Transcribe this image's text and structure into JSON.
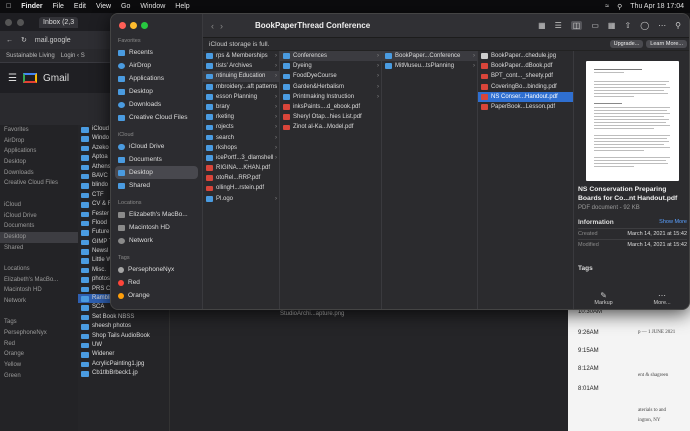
{
  "menubar": {
    "app": "Finder",
    "items": [
      "File",
      "Edit",
      "View",
      "Go",
      "Window",
      "Help"
    ],
    "datetime": "Thu Apr 18  17:04"
  },
  "chrome": {
    "tab_title": "Inbox (2,3",
    "url": "mail.google",
    "bookmarks": [
      "Sustainable Living",
      "Login ‹ S"
    ],
    "gmail_label": "Gmail"
  },
  "colors": {
    "accent": "#2f6fd0",
    "folder": "#4a9be0",
    "pdf": "#d9453a",
    "tag_red": "#ff453a",
    "tag_orange": "#ff9f0a",
    "tag_persephone": "#a5a5a5"
  },
  "bg_finder": {
    "sidebar": [
      "Favorites",
      "AirDrop",
      "Applications",
      "Desktop",
      "Downloads",
      "Creative Cloud Files",
      "",
      "iCloud",
      "iCloud Drive",
      "Documents",
      "Desktop",
      "Shared",
      "",
      "Locations",
      "Elizabeth's MacBo...",
      "Macintosh HD",
      "Network",
      "",
      "Tags",
      "PersephoneNyx",
      "Red",
      "Orange",
      "Yellow",
      "Green"
    ],
    "files": [
      "iCloud s",
      "Windo",
      "Azeko",
      "Aptoa",
      "Athens",
      "BAVC",
      "blindo",
      "CTF",
      "CV & R",
      "Fester",
      "Flood",
      "Future",
      "GIMP T",
      "Newsl",
      "Little W",
      "Misc.",
      "photosfo...ifornepaint",
      "PRS Commission",
      "Rambling...ier Press",
      "SCA",
      "Set Book NBSS",
      "sheesh photos",
      "Shop Tails AudioBook",
      "UW",
      "Widener",
      "AcrylicPainting1.jpg",
      "Cb1tlbBrbeck1.jp"
    ],
    "bottom_file": "StudioArchi...apture.png"
  },
  "calendar": {
    "times": [
      "10:30AM",
      "9:26AM",
      "9:15AM",
      "8:12AM",
      "8:01AM"
    ],
    "snips": [
      "p — 1 JUNE 2021",
      "ent & shagreen",
      "aterials to and",
      "ington, NY"
    ]
  },
  "finder": {
    "title": "BookPaperThread Conference",
    "notice": "iCloud storage is full.",
    "upgrade": "Upgrade...",
    "learn_more": "Learn More...",
    "sidebar": {
      "favorites_head": "Favorites",
      "favorites": [
        "Recents",
        "AirDrop",
        "Applications",
        "Desktop",
        "Downloads",
        "Creative Cloud Files"
      ],
      "icloud_head": "iCloud",
      "icloud": [
        "iCloud Drive",
        "Documents",
        "Desktop",
        "Shared"
      ],
      "locations_head": "Locations",
      "locations": [
        "Elizabeth's MacBo...",
        "Macintosh HD",
        "Network"
      ],
      "tags_head": "Tags",
      "tags": [
        "PersephoneNyx",
        "Red",
        "Orange"
      ]
    },
    "col1": [
      "rps & Memberships",
      "tists' Archives",
      "ntinuing Education",
      "mbroidery...aft patterns",
      "esson Planning",
      "brary",
      "rketing",
      "rojects",
      "search",
      "rkshops",
      "icePortf...3_dlamshell",
      "RIGINA....KHAN.pdf",
      "otoRel...RRP.pdf",
      "ollingH...rstein.pdf",
      "Pl.ogo"
    ],
    "col2": [
      "Conferences",
      "Dyeing",
      "FoodDyeCourse",
      "Garden&Herbalism",
      "Printmaking Instruction",
      "inksPaints....d_ebook.pdf",
      "Sheryl Otap...hies List.pdf",
      "Zinot al-Ka...Model.pdf"
    ],
    "col3": [
      "BookPaper...Conference",
      "MitMuseu...tsPlanning"
    ],
    "col4": [
      "BookPaper...chedule.jpg",
      "BookPaper...dBook.pdf",
      "BPT_cont..._sheety.pdf",
      "CoveringBo...binding.pdf",
      "NS Conser...Handout.pdf",
      "PaperBook...Lesson.pdf"
    ],
    "preview": {
      "name": "NS Conservation Preparing Boards for Co...nt Handout.pdf",
      "kind": "PDF document - 92 KB",
      "info_label": "Information",
      "show_more": "Show More",
      "created_label": "Created",
      "created": "March 14, 2021 at 15:42",
      "modified_label": "Modified",
      "modified": "March 14, 2021 at 15:42",
      "tags_label": "Tags",
      "markup": "Markup",
      "more": "More..."
    }
  }
}
